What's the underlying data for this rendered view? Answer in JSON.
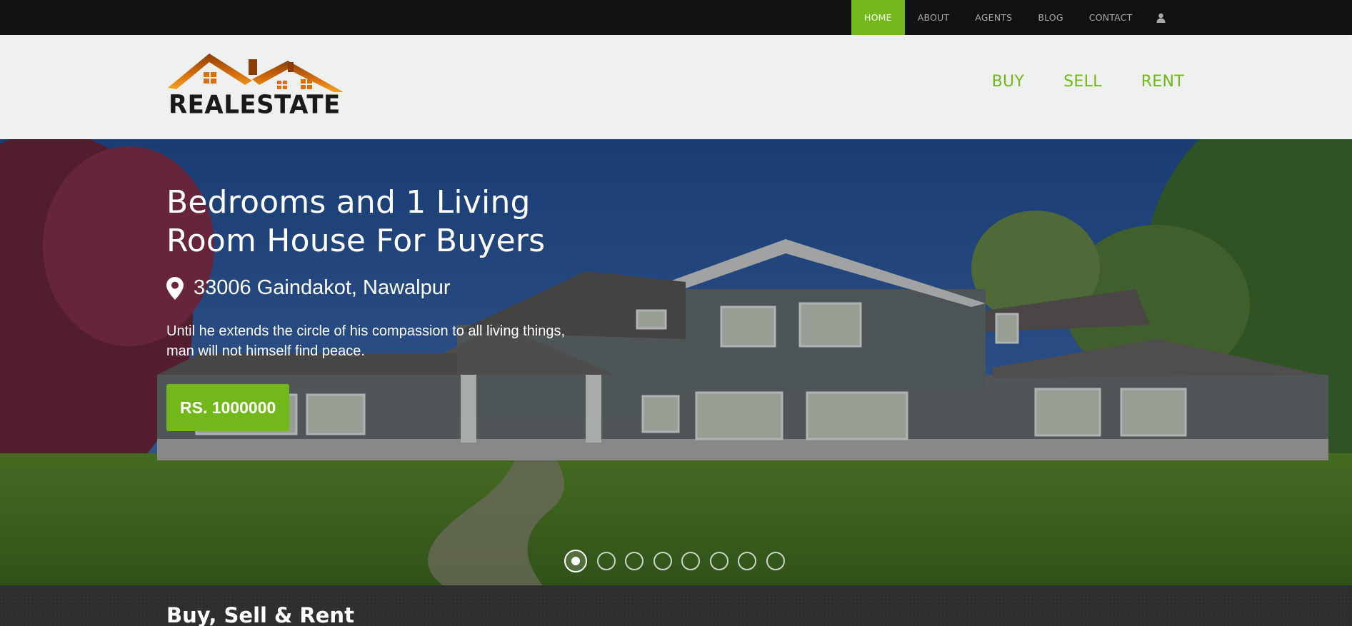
{
  "topnav": {
    "items": [
      "HOME",
      "ABOUT",
      "AGENTS",
      "BLOG",
      "CONTACT"
    ],
    "active": "HOME",
    "user_icon": "user-icon"
  },
  "header": {
    "logo_text": "REALESTATE",
    "nav": [
      "BUY",
      "SELL",
      "RENT"
    ]
  },
  "hero": {
    "title_line1": "Bedrooms and 1 Living",
    "title_line2": "Room House For Buyers",
    "location_icon": "map-pin-icon",
    "location": "33006 Gaindakot, Nawalpur",
    "description": "Until he extends the circle of his compassion to all living things, man will not himself find peace.",
    "price": "RS. 1000000",
    "slides_total": 8,
    "slide_active": 1
  },
  "section": {
    "title": "Buy, Sell & Rent"
  },
  "colors": {
    "accent": "#72b81a",
    "topbar": "#111111",
    "header_bg": "#f0f1f1"
  }
}
